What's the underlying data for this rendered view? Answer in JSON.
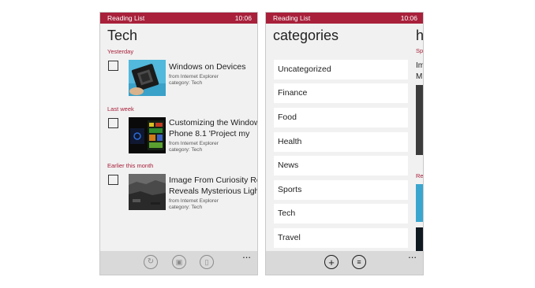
{
  "status_bar": {
    "app_name": "Reading List",
    "time": "10:06"
  },
  "left_screen": {
    "title": "Tech",
    "groups": [
      {
        "header": "Yesterday",
        "item": {
          "title_line1": "Windows on Devices",
          "title_line2": "",
          "source": "from Internet Explorer",
          "category": "category: Tech"
        }
      },
      {
        "header": "Last week",
        "item": {
          "title_line1": "Customizing the Window",
          "title_line2": "Phone 8.1 'Project my",
          "source": "from Internet Explorer",
          "category": "category: Tech"
        }
      },
      {
        "header": "Earlier this month",
        "item": {
          "title_line1": "Image From Curiosity Ro",
          "title_line2": "Reveals Mysterious Ligh",
          "source": "from Internet Explorer",
          "category": "category: Tech"
        }
      }
    ],
    "more_label": "..."
  },
  "right_screen": {
    "title": "categories",
    "categories": [
      "Uncategorized",
      "Finance",
      "Food",
      "Health",
      "News",
      "Sports",
      "Tech",
      "Travel"
    ],
    "more_label": "...",
    "peek": {
      "title": "h",
      "group1": "Sp",
      "line1": "Im",
      "line2": "M",
      "group2": "Re"
    }
  },
  "colors": {
    "accent": "#a8203a",
    "background": "#f1f1f1",
    "appbar": "#d9d9d9"
  }
}
